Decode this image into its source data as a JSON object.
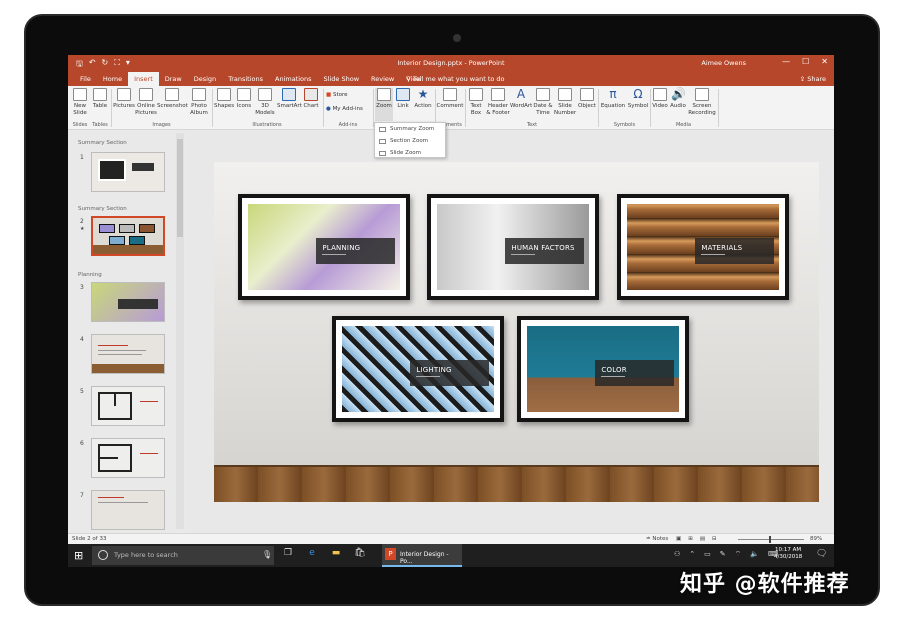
{
  "window": {
    "document_title": "Interior Design.pptx  -  PowerPoint",
    "user_name": "Aimee Owens",
    "controls": [
      "—",
      "☐",
      "✕"
    ]
  },
  "qat": {
    "save": "🖫",
    "undo": "↶",
    "redo": "↻",
    "present": "⛶",
    "more": "▾"
  },
  "ribbon_tabs": [
    "File",
    "Home",
    "Insert",
    "Draw",
    "Design",
    "Transitions",
    "Animations",
    "Slide Show",
    "Review",
    "View"
  ],
  "active_tab": "Insert",
  "tell_me": "Tell me what you want to do",
  "share": "Share",
  "ribbon": {
    "buttons": {
      "new_slide": "New Slide",
      "table": "Table",
      "pictures": "Pictures",
      "online_pictures": "Online Pictures",
      "screenshot": "Screenshot",
      "photo_album": "Photo Album",
      "shapes": "Shapes",
      "icons": "Icons",
      "models_3d": "3D Models",
      "smartart": "SmartArt",
      "chart": "Chart",
      "store": "Store",
      "my_addins": "My Add-ins",
      "zoom": "Zoom",
      "link": "Link",
      "action": "Action",
      "comment": "Comment",
      "text_box": "Text Box",
      "header_footer": "Header & Footer",
      "wordart": "WordArt",
      "date_time": "Date & Time",
      "slide_number": "Slide Number",
      "object": "Object",
      "equation": "Equation",
      "symbol": "Symbol",
      "video": "Video",
      "audio": "Audio",
      "screen_recording": "Screen Recording"
    },
    "groups": {
      "slides": "Slides",
      "tables": "Tables",
      "images": "Images",
      "illustrations": "Illustrations",
      "addins": "Add-ins",
      "comments": "omments",
      "text": "Text",
      "symbols": "Symbols",
      "media": "Media"
    }
  },
  "zoom_menu": [
    "Summary Zoom",
    "Section Zoom",
    "Slide Zoom"
  ],
  "slide_panel": {
    "sections": [
      "Summary Section",
      "Summary Section",
      "Planning"
    ],
    "slide_numbers": [
      "1",
      "2",
      "3",
      "4",
      "5",
      "6",
      "7"
    ],
    "star": "★"
  },
  "slide": {
    "frames": [
      "PLANNING",
      "HUMAN FACTORS",
      "MATERIALS",
      "LIGHTING",
      "COLOR"
    ]
  },
  "statusbar": {
    "slide_count": "Slide 2 of 33",
    "notes": "≐ Notes",
    "zoom": "89%"
  },
  "taskbar": {
    "search_placeholder": "Type here to search",
    "active_app": "Interior Design - Po...",
    "time": "10:17 AM",
    "date": "4/30/2018"
  },
  "watermark": "知乎 @软件推荐"
}
